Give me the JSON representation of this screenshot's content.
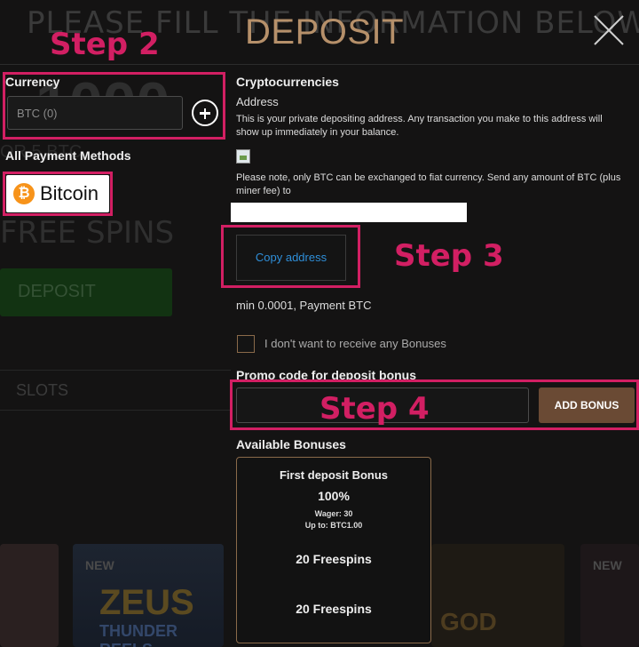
{
  "background": {
    "heading": "PLEASE FILL THE INFORMATION BELOW",
    "amount": "1000",
    "sub": "OR 5 BTC",
    "spins": "FREE SPINS",
    "deposit_button": "DEPOSIT",
    "slots_tab": "SLOTS",
    "game_badge_new": "NEW",
    "game_zeus_title": "ZEUS",
    "game_zeus_sub": "THUNDER REELS",
    "game_god_title": "GOD"
  },
  "modal": {
    "title": "DEPOSIT",
    "currency_label": "Currency",
    "currency_value": "BTC (0)",
    "payment_methods_label": "All Payment Methods",
    "bitcoin_label": "Bitcoin",
    "crypto_title": "Cryptocurrencies",
    "address_title": "Address",
    "address_desc": "This is your private depositing address. Any transaction you make to this address will show up immediately in your balance.",
    "note": "Please note, only BTC can be exchanged to fiat currency. Send any amount of BTC (plus miner fee) to",
    "address_value": "",
    "copy_button": "Copy address",
    "min_text": "min 0.0001, Payment BTC",
    "no_bonus_label": "I don't want to receive any Bonuses",
    "promo_title": "Promo code for deposit bonus",
    "promo_placeholder": "",
    "add_bonus_button": "ADD BONUS",
    "available_title": "Available Bonuses",
    "bonus_card": {
      "title": "First deposit Bonus",
      "percent": "100%",
      "wager": "Wager: 30",
      "upto": "Up to: BTC1.00",
      "freespins_1": "20 Freespins",
      "freespins_2": "20 Freespins"
    }
  },
  "overlay": {
    "step2": "Step 2",
    "step3": "Step 3",
    "step4": "Step 4",
    "highlight_color": "#d21f63"
  },
  "colors": {
    "accent": "#b6906a",
    "button_brown": "#6a4a34",
    "link_blue": "#2f8fd9",
    "bitcoin_orange": "#f7931a"
  }
}
